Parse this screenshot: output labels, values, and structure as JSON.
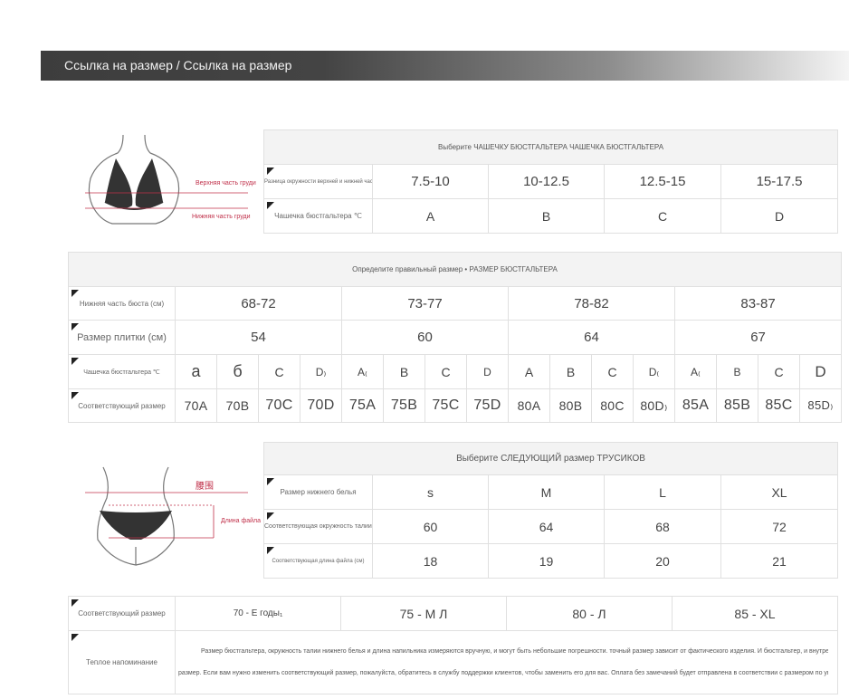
{
  "header": {
    "title": "Ссылка на размер / Ссылка на размер"
  },
  "cup_table": {
    "title": "Выберите ЧАШЕЧКУ БЮСТГАЛЬТЕРА ЧАШЕЧКА БЮСТГАЛЬТЕРА",
    "row1_label": "Разница окружности верхней и нижней части груди (см)",
    "row2_label": "Чашечка бюстгальтера ℃",
    "ranges": [
      "7.5-10",
      "10-12.5",
      "12.5-15",
      "15-17.5"
    ],
    "cups": [
      "A",
      "B",
      "C",
      "D"
    ]
  },
  "bust_figure": {
    "label_upper": "Верхняя часть груди",
    "label_lower": "Нижняя часть груди"
  },
  "bra_table": {
    "title": "Определите правильный размер • РАЗМЕР БЮСТГАЛЬТЕРА",
    "row_labels": [
      "Нижняя часть бюста (см)",
      "Размер плитки (см)",
      "Чашечка бюстгальтера ℃",
      "Соответствующий размер"
    ],
    "underbust": [
      "68-72",
      "73-77",
      "78-82",
      "83-87"
    ],
    "band": [
      "54",
      "60",
      "64",
      "67"
    ],
    "cups": [
      "а",
      "б",
      "C",
      "D₎",
      "A₍",
      "B",
      "C",
      "D",
      "A",
      "B",
      "C",
      "D₍",
      "A₍",
      "B",
      "C",
      "D"
    ],
    "sizes": [
      "70A",
      "70B",
      "70C",
      "70D",
      "75A",
      "75B",
      "75C",
      "75D",
      "80A",
      "80B",
      "80C",
      "80D₎",
      "85A",
      "85B",
      "85C",
      "85D₎"
    ]
  },
  "waist_figure": {
    "label_top": "腰围",
    "label_right": "Длина файла"
  },
  "panty_table": {
    "title": "Выберите СЛЕДУЮЩИЙ размер ТРУСИКОВ",
    "row_labels": [
      "Размер нижнего белья",
      "Соответствующая окружность талии (см)",
      "Соответствующая длина файла (см)"
    ],
    "sizes": [
      "s",
      "M",
      "L",
      "XL"
    ],
    "waist": [
      "60",
      "64",
      "68",
      "72"
    ],
    "length": [
      "18",
      "19",
      "20",
      "21"
    ]
  },
  "match_table": {
    "row1_label": "Соответствующий размер",
    "row2_label": "Теплое напоминание",
    "matches": [
      "70 - Е годы₁",
      "75 - М Л",
      "80 - Л",
      "85 - XL"
    ],
    "note_line1": "Размер бюстгальтера, окружность талии нижнего белья и длина напильника измеряются вручную, и могут быть небольшие погрешности. точный размер зависит от фактического изделия. И бюстгальтер, и внутренний ряд имеют соответствующий",
    "note_line2": "размер. Если вам нужно изменить соответствующий размер, пожалуйста, обратитесь в службу поддержки клиентов, чтобы заменить его для вас. Оплата без замечаний будет отправлена в соответствии с размером по умолчанию."
  }
}
